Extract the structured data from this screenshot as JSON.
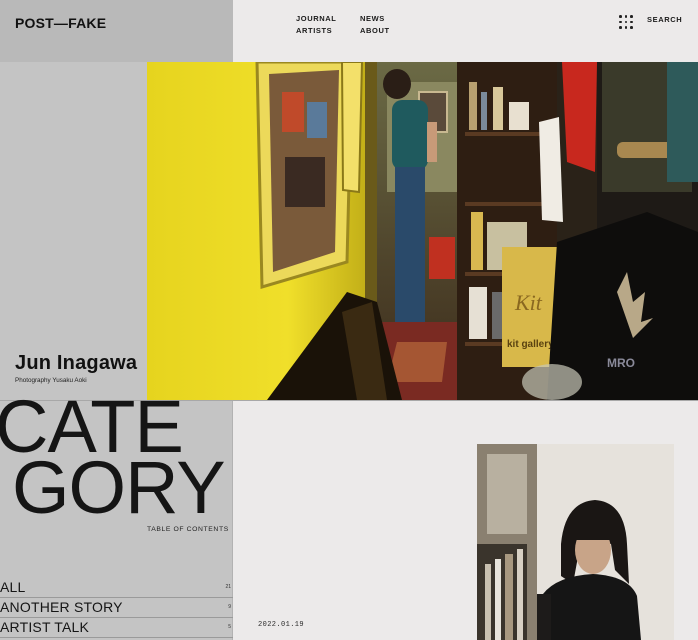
{
  "brand": {
    "logo": "POST—FAKE"
  },
  "nav": {
    "col1": [
      "JOURNAL",
      "ARTISTS"
    ],
    "col2": [
      "NEWS",
      "ABOUT"
    ],
    "search_label": "SEARCH",
    "menu_icon": "grid-dots-icon"
  },
  "hero": {
    "title": "Jun Inagawa",
    "credit": "Photography Yusaku Aoki"
  },
  "category": {
    "heading_line1": "CATE",
    "heading_line2": "GORY",
    "toc_label": "TABLE OF CONTENTS",
    "items": [
      {
        "label": "ALL",
        "count": "21"
      },
      {
        "label": "ANOTHER STORY",
        "count": "9"
      },
      {
        "label": "ARTIST TALK",
        "count": "5"
      }
    ]
  },
  "article": {
    "date": "2022.01.19"
  },
  "colors": {
    "left_panel": "#c4c4c4",
    "background": "#eceaea",
    "text": "#1b1b1b"
  }
}
